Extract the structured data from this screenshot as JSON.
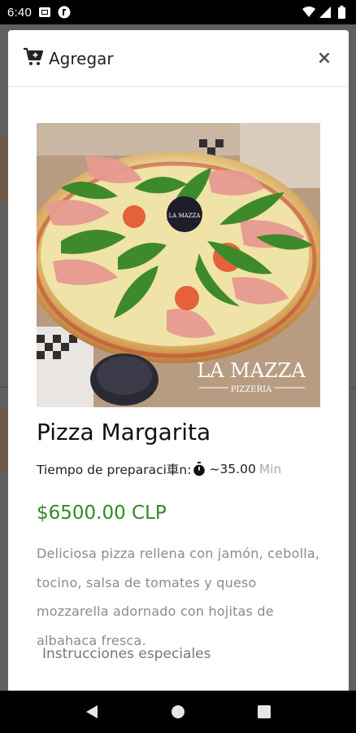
{
  "status_bar": {
    "time": "6:40",
    "icons": [
      "sim-card-icon",
      "app-notification-icon",
      "wifi-icon",
      "signal-icon",
      "battery-icon"
    ]
  },
  "dialog": {
    "title": "Agregar",
    "title_icon": "cart-plus-icon",
    "close_icon": "close-icon",
    "close_label": "×"
  },
  "product": {
    "image_alt": "pizza-photo",
    "image_overlay": {
      "brand": "LA MAZZA",
      "sub": "PIZZERIA",
      "tag": "LA MAZZA"
    },
    "name": "Pizza Margarita",
    "prep_label": "Tiempo de preparaci車n:",
    "prep_value": "~35.00",
    "prep_unit": "Min",
    "price": "$6500.00 CLP",
    "description": "Deliciosa pizza rellena con jamón, cebolla, tocino, salsa de tomates y queso mozzarella adornado con hojitas de albahaca fresca.",
    "instructions_label": "Instrucciones especiales"
  },
  "nav_bar": {
    "back_icon": "back-triangle-icon",
    "home_icon": "home-circle-icon",
    "recents_icon": "recents-square-icon"
  },
  "colors": {
    "price": "#2e8b22",
    "accent_text": "#222222",
    "muted_text": "#8b8b8b"
  }
}
